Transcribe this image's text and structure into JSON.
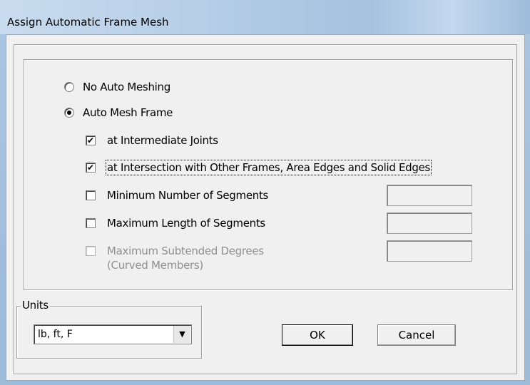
{
  "window": {
    "title": "Assign Automatic Frame Mesh"
  },
  "mesh_options": {
    "no_auto_meshing": {
      "label": "No Auto Meshing",
      "selected": false
    },
    "auto_mesh_frame": {
      "label": "Auto Mesh Frame",
      "selected": true
    }
  },
  "sub_options": [
    {
      "label": "at Intermediate Joints",
      "checked": true,
      "enabled": true
    },
    {
      "label": "at Intersection with Other Frames,  Area Edges and Solid Edges",
      "checked": true,
      "enabled": true
    },
    {
      "label": "Minimum Number of Segments",
      "checked": false,
      "enabled": true,
      "value": ""
    },
    {
      "label": "Maximum Length of Segments",
      "checked": false,
      "enabled": true,
      "value": ""
    },
    {
      "label": "Maximum Subtended Degrees",
      "sublabel": "(Curved Members)",
      "checked": false,
      "enabled": false,
      "value": ""
    }
  ],
  "units": {
    "legend": "Units",
    "selected": "lb, ft, F"
  },
  "buttons": {
    "ok": "OK",
    "cancel": "Cancel"
  },
  "icons": {
    "check": "✔",
    "dropdown": "▼"
  }
}
